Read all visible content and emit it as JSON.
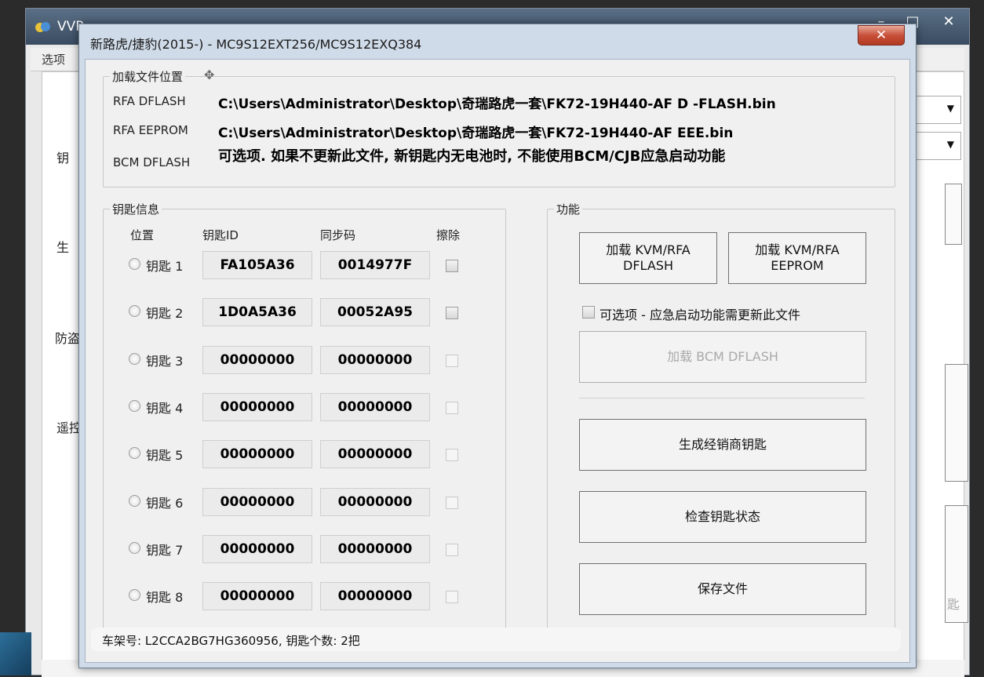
{
  "background_window": {
    "title": "VVP...",
    "menu": "选项",
    "labels": [
      "钥",
      "生",
      "防盗",
      "遥控"
    ],
    "panel_text": "匙"
  },
  "dialog": {
    "title": "新路虎/捷豹(2015-) - MC9S12EXT256/MC9S12EXQ384",
    "close_icon": "close-icon",
    "file_location": {
      "legend": "加载文件位置",
      "rows": [
        {
          "label": "RFA DFLASH",
          "value": "C:\\Users\\Administrator\\Desktop\\奇瑞路虎一套\\FK72-19H440-AF  D -FLASH.bin"
        },
        {
          "label": "RFA EEPROM",
          "value": "C:\\Users\\Administrator\\Desktop\\奇瑞路虎一套\\FK72-19H440-AF  EEE.bin"
        },
        {
          "label": "BCM DFLASH",
          "value": "可选项. 如果不更新此文件, 新钥匙内无电池时, 不能使用BCM/CJB应急启动功能"
        }
      ]
    },
    "key_info": {
      "legend": "钥匙信息",
      "headers": {
        "position": "位置",
        "key_id": "钥匙ID",
        "sync_code": "同步码",
        "erase": "擦除"
      },
      "keys": [
        {
          "label": "钥匙 1",
          "id": "FA105A36",
          "sync": "0014977F",
          "erase_active": true
        },
        {
          "label": "钥匙 2",
          "id": "1D0A5A36",
          "sync": "00052A95",
          "erase_active": true
        },
        {
          "label": "钥匙 3",
          "id": "00000000",
          "sync": "00000000",
          "erase_active": false
        },
        {
          "label": "钥匙 4",
          "id": "00000000",
          "sync": "00000000",
          "erase_active": false
        },
        {
          "label": "钥匙 5",
          "id": "00000000",
          "sync": "00000000",
          "erase_active": false
        },
        {
          "label": "钥匙 6",
          "id": "00000000",
          "sync": "00000000",
          "erase_active": false
        },
        {
          "label": "钥匙 7",
          "id": "00000000",
          "sync": "00000000",
          "erase_active": false
        },
        {
          "label": "钥匙 8",
          "id": "00000000",
          "sync": "00000000",
          "erase_active": false
        }
      ]
    },
    "functions": {
      "legend": "功能",
      "load_dflash": "加载 KVM/RFA DFLASH",
      "load_eeprom": "加载 KVM/RFA EEPROM",
      "optional_checkbox": "可选项 - 应急启动功能需更新此文件",
      "load_bcm": "加载 BCM DFLASH",
      "generate_key": "生成经销商钥匙",
      "check_status": "检查钥匙状态",
      "save_file": "保存文件"
    },
    "status": "车架号: L2CCA2BG7HG360956, 钥匙个数: 2把"
  }
}
